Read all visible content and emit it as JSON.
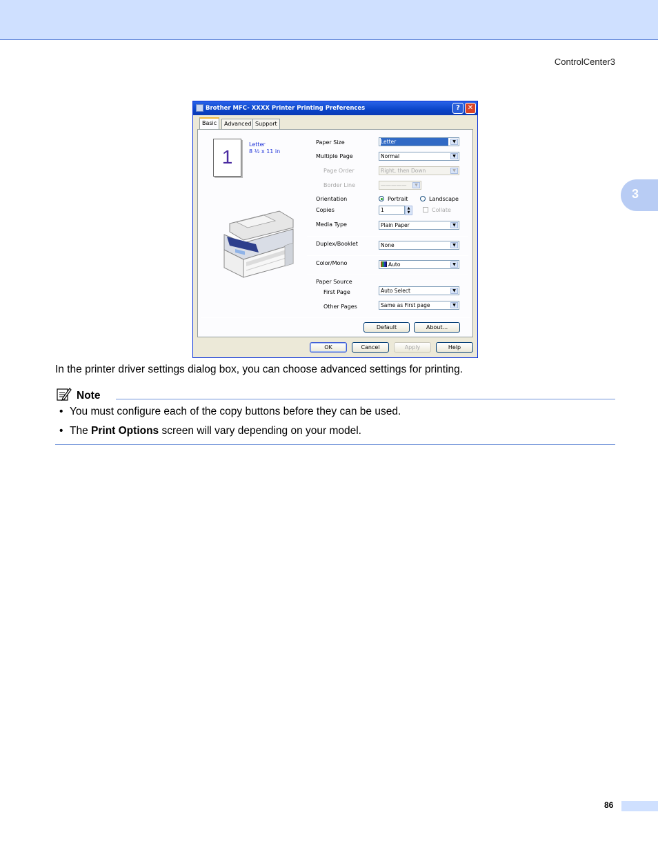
{
  "header": {
    "section": "ControlCenter3"
  },
  "chapter_tab": {
    "number": "3"
  },
  "dialog": {
    "title": "Brother MFC- XXXX Printer Printing Preferences",
    "help_button": "?",
    "close_button": "✕",
    "tabs": [
      "Basic",
      "Advanced",
      "Support"
    ],
    "paper_icon_number": "1",
    "paper_name": "Letter",
    "paper_dimensions": "8 ½ x 11 in",
    "fields": {
      "paper_size": {
        "label": "Paper Size",
        "value": "Letter"
      },
      "multiple_page": {
        "label": "Multiple Page",
        "value": "Normal"
      },
      "page_order": {
        "label": "Page Order",
        "value": "Right, then Down"
      },
      "border_line": {
        "label": "Border Line",
        "value": "—————"
      },
      "orientation": {
        "label": "Orientation",
        "portrait": "Portrait",
        "landscape": "Landscape"
      },
      "copies": {
        "label": "Copies",
        "value": "1",
        "collate": "Collate"
      },
      "media_type": {
        "label": "Media Type",
        "value": "Plain Paper"
      },
      "duplex": {
        "label": "Duplex/Booklet",
        "value": "None"
      },
      "color_mono": {
        "label": "Color/Mono",
        "value": "Auto"
      },
      "paper_source": {
        "label": "Paper Source"
      },
      "first_page": {
        "label": "First Page",
        "value": "Auto Select"
      },
      "other_pages": {
        "label": "Other Pages",
        "value": "Same as First page"
      }
    },
    "panel_buttons": {
      "default": "Default",
      "about": "About..."
    },
    "footer_buttons": {
      "ok": "OK",
      "cancel": "Cancel",
      "apply": "Apply",
      "help": "Help"
    }
  },
  "body": {
    "paragraph": "In the printer driver settings dialog box, you can choose advanced settings for printing.",
    "note_title": "Note",
    "bullets": {
      "b1": "You must configure each of the copy buttons before they can be used.",
      "b2_prefix": "The ",
      "b2_bold": "Print Options",
      "b2_suffix": " screen will vary depending on your model."
    },
    "bullet_symbol": "•"
  },
  "footer": {
    "page_number": "86"
  }
}
